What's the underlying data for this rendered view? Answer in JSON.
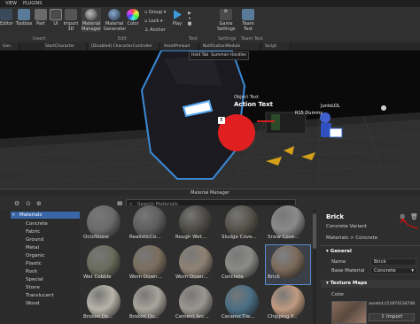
{
  "menu": {
    "items": [
      "VIEW",
      "PLUGINS"
    ]
  },
  "ribbon": {
    "buttons": [
      {
        "label": "Editor"
      },
      {
        "label": "Toolbox"
      },
      {
        "label": "Part"
      },
      {
        "label": "UI"
      },
      {
        "label": "Import 3D"
      },
      {
        "label": "Material Manager"
      },
      {
        "label": "Material Generator"
      },
      {
        "label": "Color"
      },
      {
        "label": "Play"
      },
      {
        "label": "Game Settings"
      },
      {
        "label": "Team Test"
      }
    ],
    "small": {
      "group": "Group",
      "lock": "Lock",
      "anchor": "Anchor"
    },
    "groups": {
      "insert": "Insert",
      "edit": "Edit",
      "test": "Test",
      "settings": "Settings",
      "team_test": "Team Test"
    }
  },
  "tabs": [
    {
      "label": "Gen"
    },
    {
      "label": "StartCharacter"
    },
    {
      "label": "[Disabled] CharacterController"
    },
    {
      "label": "AssetPreload"
    },
    {
      "label": "NotificationModule"
    },
    {
      "label": "Script"
    }
  ],
  "viewport": {
    "tooltip_tabs": [
      "Hold Tab",
      "Summon Handles"
    ],
    "object_text": "Object Text",
    "action_text": "Action Text",
    "key_hint": "E",
    "r15": "R15 Dummy",
    "player": "JunioLOL"
  },
  "material_manager": {
    "title": "Material Manager",
    "search_placeholder": "Search Materials",
    "root": "Materials",
    "categories": [
      "Concrete",
      "Fabric",
      "Ground",
      "Metal",
      "Organic",
      "Plastic",
      "Rock",
      "Special",
      "Stone",
      "Translucent",
      "Wood"
    ],
    "tiles": [
      {
        "label": "OctoStone",
        "color": "#6b6b6b"
      },
      {
        "label": "RealisticCo...",
        "color": "#5e5e5e"
      },
      {
        "label": "Rough Wet...",
        "color": "#4c4a45"
      },
      {
        "label": "Sludge Cove...",
        "color": "#55524a"
      },
      {
        "label": "Snow Cove...",
        "color": "#8a8a8a"
      },
      {
        "label": "Wet Cobble",
        "color": "#6a6c5c"
      },
      {
        "label": "Worn Down...",
        "color": "#7a6e5e"
      },
      {
        "label": "Worn Down...",
        "color": "#8e8274"
      },
      {
        "label": "Concrete",
        "color": "#8a8a86"
      },
      {
        "label": "Brick",
        "color": "#7b6a5a"
      },
      {
        "label": "Broken Do...",
        "color": "#b8b4aa"
      },
      {
        "label": "Broken Do...",
        "color": "#a8a49c"
      },
      {
        "label": "Cement Arc...",
        "color": "#9a9690"
      },
      {
        "label": "CeramicTile...",
        "color": "#4a6e84"
      },
      {
        "label": "Chipping P...",
        "color": "#c09a80"
      }
    ],
    "detail": {
      "name": "Brick",
      "variant": "Concrete Variant",
      "path": "Materials > Concrete",
      "general": "General",
      "name_label": "Name",
      "name_value": "Brick",
      "base_label": "Base Material",
      "base_value": "Concrete",
      "texture_maps": "Texture Maps",
      "color_label": "Color",
      "asset": "assetid://11874134748",
      "import": "Import"
    }
  }
}
